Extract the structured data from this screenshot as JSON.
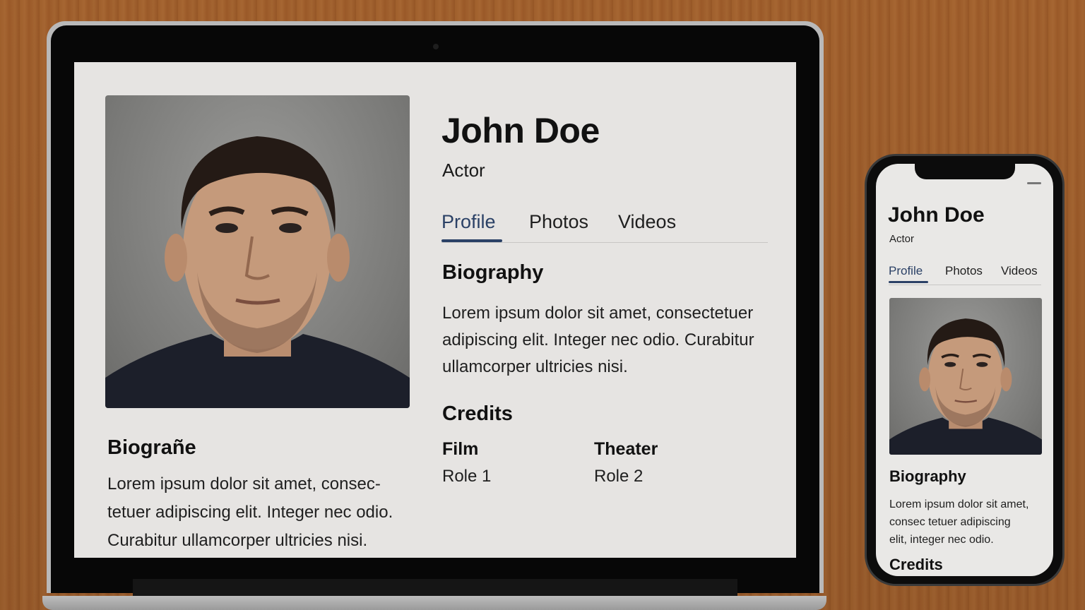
{
  "laptop": {
    "name": "John Doe",
    "role": "Actor",
    "tabs": [
      {
        "label": "Profile",
        "active": true
      },
      {
        "label": "Photos",
        "active": false
      },
      {
        "label": "Videos",
        "active": false
      }
    ],
    "biography": {
      "title": "Biography",
      "text": "Lorem ipsum dolor sit amet, consectetuer adipiscing elit. Integer nec odio. Curabitur ullamcorper ultricies nisi."
    },
    "credits": {
      "title": "Credits",
      "columns": [
        {
          "heading": "Film",
          "items": [
            "Role 1"
          ]
        },
        {
          "heading": "Theater",
          "items": [
            "Role 2"
          ]
        }
      ]
    },
    "biography_secondary": {
      "title": "Biograñe",
      "lines": [
        "Lorem ipsum dolor sit amet, consec-",
        "tetuer adipiscing elit. Integer nec odio.",
        "Curabitur ullamcorper ultricies nisi."
      ]
    }
  },
  "phone": {
    "name": "John Doe",
    "role": "Actor",
    "tabs": [
      {
        "label": "Profile",
        "active": true
      },
      {
        "label": "Photos",
        "active": false
      },
      {
        "label": "Videos",
        "active": false
      }
    ],
    "biography": {
      "title": "Biography",
      "lines": [
        "Lorem ipsum dolor sit amet,",
        "consec tetuer adipiscing",
        "elit, integer nec odio."
      ]
    },
    "credits_title": "Credits"
  },
  "colors": {
    "accent": "#2b4166",
    "screen_bg": "#e6e4e2",
    "text": "#111111"
  }
}
